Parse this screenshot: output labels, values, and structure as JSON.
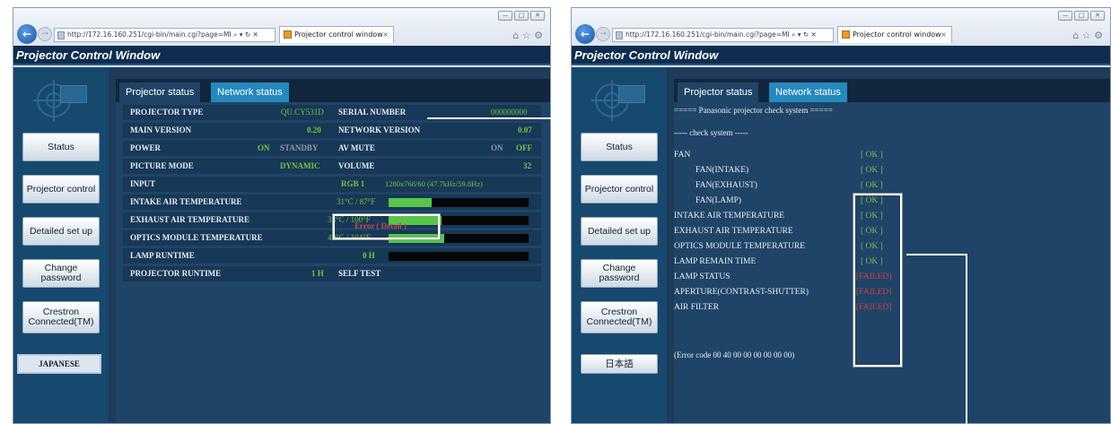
{
  "browser": {
    "address": "http://172.16.160.251/cgi-bin/main.cgi?page=MI",
    "address_controls": "⌕ ▾ ↻ ✕",
    "tab_title": "Projector control window",
    "tab_title_right": "Projector control window"
  },
  "app": {
    "title": "Projector Control Window"
  },
  "sidebar": {
    "status": "Status",
    "projector_control": "Projector control",
    "detailed_setup": "Detailed set up",
    "change_password": "Change password",
    "crestron": "Crestron Connected(TM)",
    "language_left": "JAPANESE",
    "language_right": "日本語"
  },
  "tabs": {
    "projector_status": "Projector status",
    "network_status": "Network status"
  },
  "status": {
    "projector_type_label": "PROJECTOR TYPE",
    "projector_type": "QU.CY531D",
    "serial_number_label": "SERIAL NUMBER",
    "serial_number": "000000000",
    "main_version_label": "MAIN VERSION",
    "main_version": "0.20",
    "network_version_label": "NETWORK VERSION",
    "network_version": "0.07",
    "power_label": "POWER",
    "power_on": "ON",
    "power_standby": "STANDBY",
    "av_mute_label": "AV MUTE",
    "av_mute_on": "ON",
    "av_mute_off": "OFF",
    "picture_mode_label": "PICTURE MODE",
    "picture_mode": "DYNAMIC",
    "volume_label": "VOLUME",
    "volume": "32",
    "input_label": "INPUT",
    "input": "RGB 1",
    "input_signal": "1280x768/60 (47.7kHz/59.8Hz)",
    "intake_label": "INTAKE AIR TEMPERATURE",
    "intake": "31°C / 87°F",
    "intake_level": 0.31,
    "exhaust_label": "EXHAUST AIR TEMPERATURE",
    "exhaust": "38°C / 100°F",
    "exhaust_level": 0.38,
    "optics_label": "OPTICS MODULE TEMPERATURE",
    "optics": "40°C / 104°F",
    "optics_level": 0.4,
    "lamp_runtime_label": "LAMP RUNTIME",
    "lamp_runtime": "0 H",
    "projector_runtime_label": "PROJECTOR RUNTIME",
    "projector_runtime": "1 H",
    "self_test_label": "SELF TEST",
    "self_test": "Error ( Detail )"
  },
  "check": {
    "header": "===== Panasonic projector check system =====",
    "sub": "----- check system -----",
    "items": [
      {
        "label": "FAN",
        "result": "[ OK ]",
        "status": "ok",
        "indent": false
      },
      {
        "label": "FAN(INTAKE)",
        "result": "[ OK ]",
        "status": "ok",
        "indent": true
      },
      {
        "label": "FAN(EXHAUST)",
        "result": "[ OK ]",
        "status": "ok",
        "indent": true
      },
      {
        "label": "FAN(LAMP)",
        "result": "[ OK ]",
        "status": "ok",
        "indent": true
      },
      {
        "label": "INTAKE AIR TEMPERATURE",
        "result": "[ OK ]",
        "status": "ok",
        "indent": false
      },
      {
        "label": "EXHAUST  AIR  TEMPERATURE",
        "result": "[ OK ]",
        "status": "ok",
        "indent": false
      },
      {
        "label": "OPTICS MODULE TEMPERATURE",
        "result": "[ OK ]",
        "status": "ok",
        "indent": false
      },
      {
        "label": "LAMP REMAIN TIME",
        "result": "[ OK ]",
        "status": "ok",
        "indent": false
      },
      {
        "label": "LAMP STATUS",
        "result": "[FAILED]",
        "status": "fail",
        "indent": false
      },
      {
        "label": "APERTURE(CONTRAST-SHUTTER)",
        "result": "[FAILED]",
        "status": "fail",
        "indent": false
      },
      {
        "label": "AIR FILTER",
        "result": "[FAILED]",
        "status": "fail",
        "indent": false
      }
    ],
    "error_code": "(Error code 00 40 00 00 00 00 00 00)"
  },
  "colors": {
    "ok": "#74c442",
    "fail": "#d04040",
    "titlebar": "#0f2d4e",
    "panel": "#1f4467",
    "tab_active": "#2589bd"
  }
}
